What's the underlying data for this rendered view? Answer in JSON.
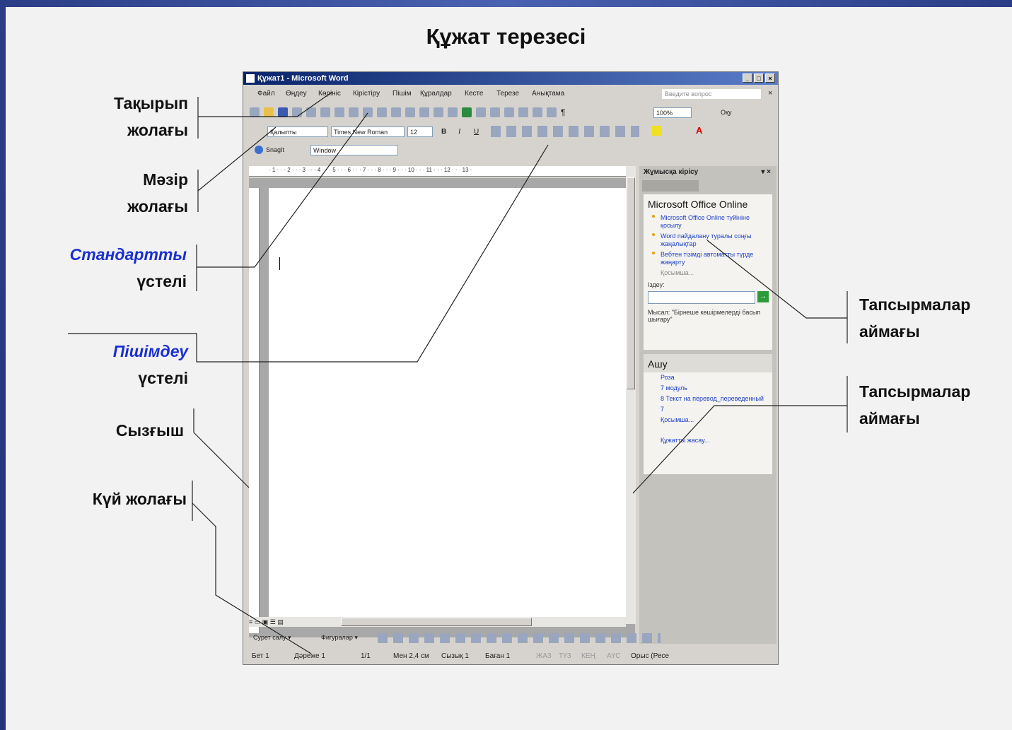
{
  "title": "Құжат терезесі",
  "labels_left": {
    "title_bar": [
      "Тақырып",
      "жолағы"
    ],
    "menu_bar": [
      "Мәзір",
      "жолағы"
    ],
    "standard": [
      "Стандартты",
      "үстелі"
    ],
    "formatting": [
      "Пішімдеу",
      "үстелі"
    ],
    "ruler": "Сызғыш",
    "status_bar": "Күй жолағы"
  },
  "labels_right": {
    "task_pane_1": [
      "Тапсырмалар",
      "аймағы"
    ],
    "task_pane_2": [
      "Тапсырмалар",
      "аймағы"
    ]
  },
  "word": {
    "window_title": "Құжат1 - Microsoft Word",
    "menu": [
      "Файл",
      "Өңдеу",
      "Көрініс",
      "Кірістіру",
      "Пішім",
      "Құралдар",
      "Кесте",
      "Терезе",
      "Анықтама"
    ],
    "help_box_placeholder": "Введите вопрос",
    "zoom": "100%",
    "read_button": "Оқу",
    "style": "Қалыпты",
    "font": "Times New Roman",
    "size": "12",
    "snagit": "SnagIt",
    "snagit_window": "Window",
    "ruler_ticks": "· 1 · · · 2 · · · 3 · · · 4 · · · 5 · · · 6 · · · 7 · · · 8 · · · 9 · · · 10 · · · 11 · · · 12 · · · 13 ·",
    "taskpane": {
      "header": "Жұмысқа кірісу",
      "office_title": "Microsoft Office Online",
      "links": [
        "Microsoft Office Online түйініне қосылу",
        "Word пайдалану туралы соңғы жаңалықтар",
        "Вебтен тізімді автоматты түрде жаңарту"
      ],
      "more1": "Қосымша...",
      "search_label": "Іздеу:",
      "example": "Мысал: \"Бірнеше көшірмелерді басып шығару\"",
      "open_title": "Ашу",
      "files": [
        "Роза",
        "7 модуль",
        "8 Текст на перевод_переведенный",
        "7"
      ],
      "more2": "Қосымша...",
      "create_doc": "Құжатты жасау..."
    },
    "drawing": {
      "draw_menu": "Сурет салу ▾",
      "autoshapes": "Фигуралар ▾"
    },
    "status": {
      "page": "Бет 1",
      "section": "Дәреже 1",
      "pages": "1/1",
      "at": "Мен 2,4 см",
      "line": "Сызық 1",
      "col": "Баған 1",
      "rec": "ЖАЗ",
      "trk": "ТҮЗ",
      "ext": "КЕҢ",
      "ovr": "АҮС",
      "lang": "Орыс (Ресе"
    }
  }
}
